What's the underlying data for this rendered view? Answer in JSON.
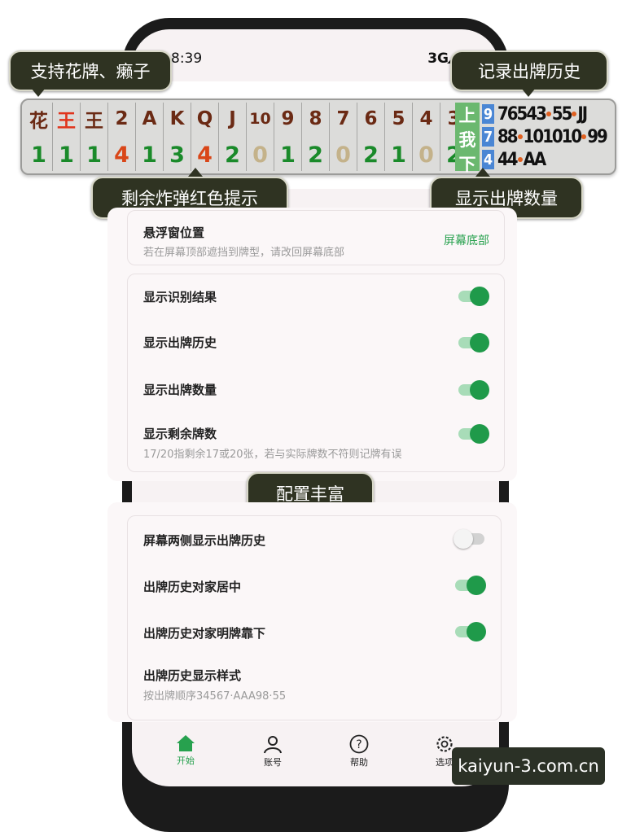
{
  "status_bar": {
    "time": "8:39",
    "network": "3G"
  },
  "callouts": {
    "top_left": "支持花牌、癞子",
    "top_right": "记录出牌历史",
    "bottom_left": "剩余炸弹红色提示",
    "bottom_right": "显示出牌数量",
    "middle": "配置丰富"
  },
  "card_tracker": {
    "columns": [
      {
        "face": "花",
        "face_color": "#6b2a14",
        "count": "1",
        "count_color": "#1a8a2a"
      },
      {
        "face": "王",
        "face_color": "#e0341c",
        "count": "1",
        "count_color": "#1a8a2a"
      },
      {
        "face": "王",
        "face_color": "#6b2a14",
        "count": "1",
        "count_color": "#1a8a2a"
      },
      {
        "face": "2",
        "face_color": "#6b2a14",
        "count": "4",
        "count_color": "#d94618"
      },
      {
        "face": "A",
        "face_color": "#6b2a14",
        "count": "1",
        "count_color": "#1a8a2a"
      },
      {
        "face": "K",
        "face_color": "#6b2a14",
        "count": "3",
        "count_color": "#1a8a2a"
      },
      {
        "face": "Q",
        "face_color": "#6b2a14",
        "count": "4",
        "count_color": "#d94618"
      },
      {
        "face": "J",
        "face_color": "#6b2a14",
        "count": "2",
        "count_color": "#1a8a2a"
      },
      {
        "face": "10",
        "face_color": "#6b2a14",
        "count": "0",
        "count_color": "#c4b28a"
      },
      {
        "face": "9",
        "face_color": "#6b2a14",
        "count": "1",
        "count_color": "#1a8a2a"
      },
      {
        "face": "8",
        "face_color": "#6b2a14",
        "count": "2",
        "count_color": "#1a8a2a"
      },
      {
        "face": "7",
        "face_color": "#6b2a14",
        "count": "0",
        "count_color": "#c4b28a"
      },
      {
        "face": "6",
        "face_color": "#6b2a14",
        "count": "2",
        "count_color": "#1a8a2a"
      },
      {
        "face": "5",
        "face_color": "#6b2a14",
        "count": "1",
        "count_color": "#1a8a2a"
      },
      {
        "face": "4",
        "face_color": "#6b2a14",
        "count": "0",
        "count_color": "#c4b28a"
      },
      {
        "face": "3",
        "face_color": "#6b2a14",
        "count": "2",
        "count_color": "#1a8a2a"
      }
    ],
    "player_labels": [
      "上",
      "我",
      "下"
    ],
    "history": [
      {
        "count": "9",
        "segments": [
          "76543",
          "55",
          "JJ"
        ]
      },
      {
        "count": "7",
        "segments": [
          "88",
          "101010",
          "99"
        ]
      },
      {
        "count": "4",
        "segments": [
          "44",
          "AA"
        ]
      }
    ]
  },
  "settings": {
    "float_position": {
      "title": "悬浮窗位置",
      "subtitle": "若在屏幕顶部遮挡到牌型，请改回屏幕底部",
      "value": "屏幕底部"
    },
    "show_recognition": {
      "title": "显示识别结果",
      "enabled": true
    },
    "show_history": {
      "title": "显示出牌历史",
      "enabled": true
    },
    "show_count": {
      "title": "显示出牌数量",
      "enabled": true
    },
    "show_remaining": {
      "title": "显示剩余牌数",
      "subtitle": "17/20指剩余17或20张，若与实际牌数不符则记牌有误",
      "enabled": true
    },
    "side_history": {
      "title": "屏幕两侧显示出牌历史",
      "enabled": false
    },
    "opponent_center": {
      "title": "出牌历史对家居中",
      "enabled": true
    },
    "opponent_bottom": {
      "title": "出牌历史对家明牌靠下",
      "enabled": true
    },
    "history_style": {
      "title": "出牌历史显示样式",
      "subtitle": "按出牌顺序34567·AAA98·55"
    }
  },
  "nav": {
    "items": [
      {
        "label": "开始",
        "icon": "home-icon",
        "active": true
      },
      {
        "label": "账号",
        "icon": "person-icon",
        "active": false
      },
      {
        "label": "帮助",
        "icon": "help-icon",
        "active": false
      },
      {
        "label": "选项",
        "icon": "gear-icon",
        "active": false
      }
    ],
    "active_color": "#27a14e"
  },
  "watermark": "kaiyun-3.com.cn"
}
